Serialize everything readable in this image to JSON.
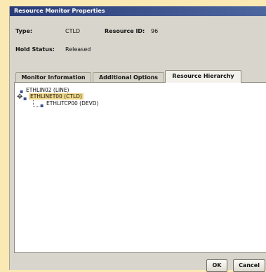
{
  "window": {
    "title": "Resource Monitor Properties"
  },
  "info": {
    "type_label": "Type:",
    "type_value": "CTLD",
    "resource_id_label": "Resource ID:",
    "resource_id_value": "96",
    "hold_status_label": "Hold Status:",
    "hold_status_value": "Released"
  },
  "tabs": [
    {
      "label": "Monitor Information",
      "active": false
    },
    {
      "label": "Additional Options",
      "active": false
    },
    {
      "label": "Resource Hierarchy",
      "active": true
    }
  ],
  "tree": [
    {
      "label": "ETHLIN02 (LINE)",
      "level": 0,
      "selected": false
    },
    {
      "label": "ETHLINET00 (CTLD)",
      "level": 1,
      "selected": true
    },
    {
      "label": "ETHLITCP00 (DEVD)",
      "level": 2,
      "selected": false
    }
  ],
  "buttons": {
    "ok": "OK",
    "cancel": "Cancel"
  },
  "icons": {
    "expand": "expand-toggle-icon",
    "line": "line-resource-icon",
    "controller": "controller-resource-icon",
    "device": "device-resource-icon"
  }
}
